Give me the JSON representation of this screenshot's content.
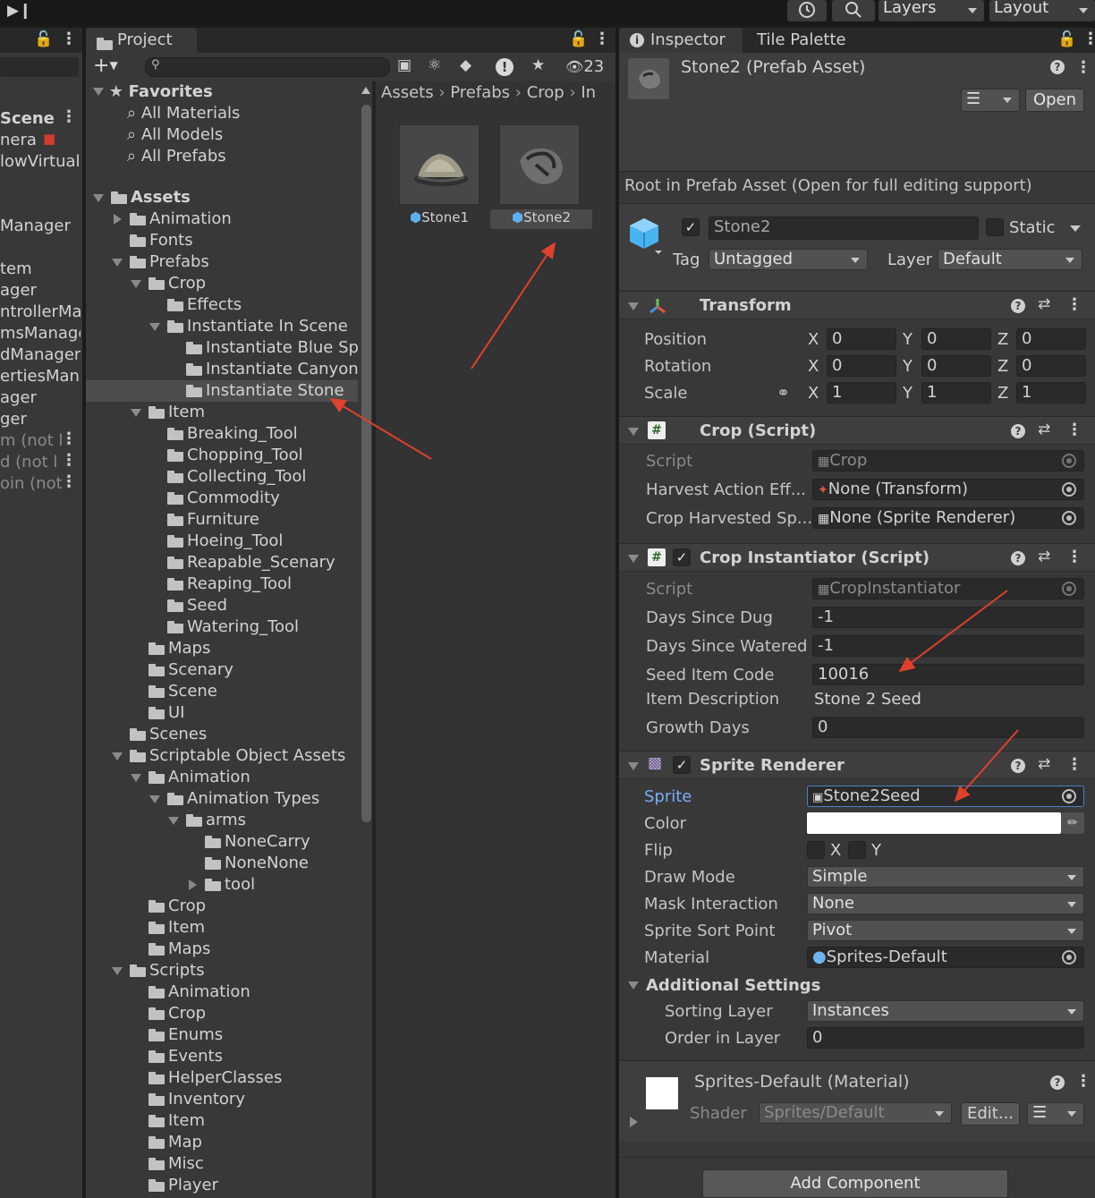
{
  "toolbar": {
    "history_icon": "history-icon",
    "search_icon": "search-icon",
    "layers_label": "Layers",
    "layout_label": "Layout",
    "step_icon": "step-icon"
  },
  "hierarchy": {
    "rows": [
      "Scene",
      "nera",
      "lowVirtualC",
      "Manager",
      "tem",
      "ager",
      "ntrollerMar",
      "msManage",
      "dManager",
      "ertiesMana",
      "ager",
      "ger",
      "m (not l",
      "d (not l",
      "oin (not"
    ]
  },
  "project": {
    "tab_label": "Project",
    "badge_count": "23",
    "favorites": {
      "label": "Favorites",
      "items": [
        "All Materials",
        "All Models",
        "All Prefabs"
      ]
    },
    "tree": [
      {
        "label": "Assets",
        "depth": 0,
        "state": "open",
        "bold": true
      },
      {
        "label": "Animation",
        "depth": 1,
        "state": "closed"
      },
      {
        "label": "Fonts",
        "depth": 1,
        "state": "none"
      },
      {
        "label": "Prefabs",
        "depth": 1,
        "state": "open"
      },
      {
        "label": "Crop",
        "depth": 2,
        "state": "open"
      },
      {
        "label": "Effects",
        "depth": 3,
        "state": "none"
      },
      {
        "label": "Instantiate In Scene",
        "depth": 3,
        "state": "open"
      },
      {
        "label": "Instantiate Blue Spr",
        "depth": 4,
        "state": "none"
      },
      {
        "label": "Instantiate Canyon",
        "depth": 4,
        "state": "none"
      },
      {
        "label": "Instantiate Stone",
        "depth": 4,
        "state": "none",
        "selected": true
      },
      {
        "label": "Item",
        "depth": 2,
        "state": "open"
      },
      {
        "label": "Breaking_Tool",
        "depth": 3,
        "state": "none"
      },
      {
        "label": "Chopping_Tool",
        "depth": 3,
        "state": "none"
      },
      {
        "label": "Collecting_Tool",
        "depth": 3,
        "state": "none"
      },
      {
        "label": "Commodity",
        "depth": 3,
        "state": "none"
      },
      {
        "label": "Furniture",
        "depth": 3,
        "state": "none"
      },
      {
        "label": "Hoeing_Tool",
        "depth": 3,
        "state": "none"
      },
      {
        "label": "Reapable_Scenary",
        "depth": 3,
        "state": "none"
      },
      {
        "label": "Reaping_Tool",
        "depth": 3,
        "state": "none"
      },
      {
        "label": "Seed",
        "depth": 3,
        "state": "none"
      },
      {
        "label": "Watering_Tool",
        "depth": 3,
        "state": "none"
      },
      {
        "label": "Maps",
        "depth": 2,
        "state": "none"
      },
      {
        "label": "Scenary",
        "depth": 2,
        "state": "none"
      },
      {
        "label": "Scene",
        "depth": 2,
        "state": "none"
      },
      {
        "label": "UI",
        "depth": 2,
        "state": "none"
      },
      {
        "label": "Scenes",
        "depth": 1,
        "state": "none"
      },
      {
        "label": "Scriptable Object Assets",
        "depth": 1,
        "state": "open"
      },
      {
        "label": "Animation",
        "depth": 2,
        "state": "open"
      },
      {
        "label": "Animation Types",
        "depth": 3,
        "state": "open"
      },
      {
        "label": "arms",
        "depth": 4,
        "state": "open"
      },
      {
        "label": "NoneCarry",
        "depth": 5,
        "state": "none"
      },
      {
        "label": "NoneNone",
        "depth": 5,
        "state": "none"
      },
      {
        "label": "tool",
        "depth": 5,
        "state": "closed"
      },
      {
        "label": "Crop",
        "depth": 2,
        "state": "none"
      },
      {
        "label": "Item",
        "depth": 2,
        "state": "none"
      },
      {
        "label": "Maps",
        "depth": 2,
        "state": "none"
      },
      {
        "label": "Scripts",
        "depth": 1,
        "state": "open"
      },
      {
        "label": "Animation",
        "depth": 2,
        "state": "none"
      },
      {
        "label": "Crop",
        "depth": 2,
        "state": "none"
      },
      {
        "label": "Enums",
        "depth": 2,
        "state": "none"
      },
      {
        "label": "Events",
        "depth": 2,
        "state": "none"
      },
      {
        "label": "HelperClasses",
        "depth": 2,
        "state": "none"
      },
      {
        "label": "Inventory",
        "depth": 2,
        "state": "none"
      },
      {
        "label": "Item",
        "depth": 2,
        "state": "none"
      },
      {
        "label": "Map",
        "depth": 2,
        "state": "none"
      },
      {
        "label": "Misc",
        "depth": 2,
        "state": "none"
      },
      {
        "label": "Player",
        "depth": 2,
        "state": "none"
      }
    ],
    "breadcrumb": [
      "Assets",
      "Prefabs",
      "Crop",
      "In"
    ],
    "assets": [
      {
        "name": "Stone1",
        "selected": false
      },
      {
        "name": "Stone2",
        "selected": true
      }
    ]
  },
  "inspector": {
    "tab_label": "Inspector",
    "tab2_label": "Tile Palette",
    "title": "Stone2 (Prefab Asset)",
    "open_label": "Open",
    "root_msg": "Root in Prefab Asset (Open for full editing support)",
    "go_name": "Stone2",
    "static_label": "Static",
    "tag_label": "Tag",
    "tag_value": "Untagged",
    "layer_label": "Layer",
    "layer_value": "Default",
    "transform": {
      "title": "Transform",
      "position_label": "Position",
      "rotation_label": "Rotation",
      "scale_label": "Scale",
      "position": [
        "0",
        "0",
        "0"
      ],
      "rotation": [
        "0",
        "0",
        "0"
      ],
      "scale": [
        "1",
        "1",
        "1"
      ],
      "x": "X",
      "y": "Y",
      "z": "Z"
    },
    "crop": {
      "title": "Crop (Script)",
      "script_label": "Script",
      "script_value": "Crop",
      "harvest_label": "Harvest Action Eff...",
      "harvest_value": "None (Transform)",
      "harvested_label": "Crop Harvested Sp...",
      "harvested_value": "None (Sprite Renderer)"
    },
    "crop_inst": {
      "title": "Crop Instantiator (Script)",
      "script_label": "Script",
      "script_value": "CropInstantiator",
      "rows": [
        {
          "label": "Days Since Dug",
          "value": "-1"
        },
        {
          "label": "Days Since Watered",
          "value": "-1"
        },
        {
          "label": "Seed Item Code",
          "value": "10016"
        }
      ],
      "desc_label": "Item Description",
      "desc_value": "Stone 2 Seed",
      "growth_label": "Growth Days",
      "growth_value": "0"
    },
    "sprite": {
      "title": "Sprite Renderer",
      "sprite_label": "Sprite",
      "sprite_value": "Stone2Seed",
      "color_label": "Color",
      "flip_label": "Flip",
      "flip_x": "X",
      "flip_y": "Y",
      "draw_label": "Draw Mode",
      "draw_value": "Simple",
      "mask_label": "Mask Interaction",
      "mask_value": "None",
      "sort_label": "Sprite Sort Point",
      "sort_value": "Pivot",
      "material_label": "Material",
      "material_value": "Sprites-Default",
      "additional_label": "Additional Settings",
      "sorting_layer_label": "Sorting Layer",
      "sorting_layer_value": "Instances",
      "order_label": "Order in Layer",
      "order_value": "0"
    },
    "material": {
      "title": "Sprites-Default (Material)",
      "shader_label": "Shader",
      "shader_value": "Sprites/Default",
      "edit_label": "Edit..."
    },
    "add_component": "Add Component"
  },
  "colors": {
    "accent_blue": "#4c7fc7",
    "annotation_red": "#e0412c",
    "selected_row": "#4d4d4d"
  }
}
